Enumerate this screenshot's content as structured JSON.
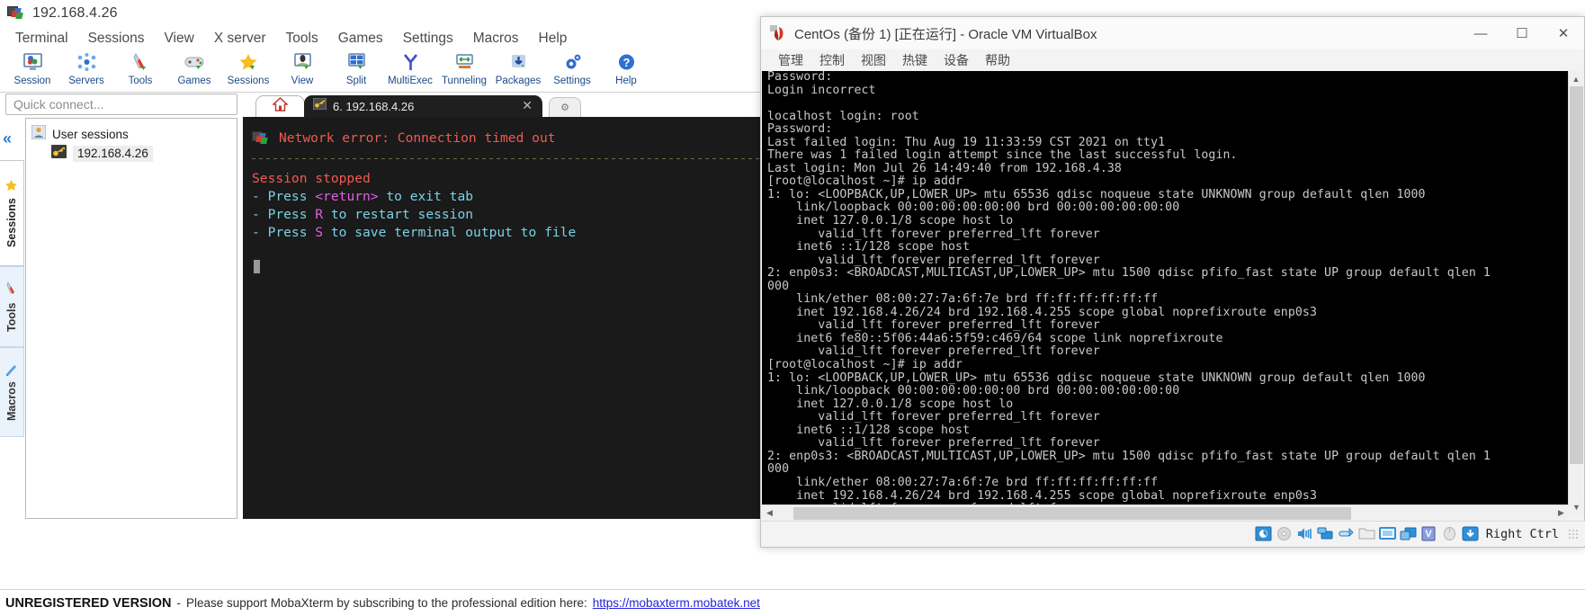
{
  "mobaxterm": {
    "title": "192.168.4.26",
    "title_icon": "mobaxterm-logo-icon",
    "menus": [
      "Terminal",
      "Sessions",
      "View",
      "X server",
      "Tools",
      "Games",
      "Settings",
      "Macros",
      "Help"
    ],
    "toolbar": [
      {
        "label": "Session",
        "icon": "session-icon"
      },
      {
        "label": "Servers",
        "icon": "servers-icon"
      },
      {
        "label": "Tools",
        "icon": "tools-icon"
      },
      {
        "label": "Games",
        "icon": "games-icon"
      },
      {
        "label": "Sessions",
        "icon": "sessions-star-icon"
      },
      {
        "label": "View",
        "icon": "view-icon"
      },
      {
        "label": "Split",
        "icon": "split-icon"
      },
      {
        "label": "MultiExec",
        "icon": "multiexec-icon"
      },
      {
        "label": "Tunneling",
        "icon": "tunneling-icon"
      },
      {
        "label": "Packages",
        "icon": "packages-icon"
      },
      {
        "label": "Settings",
        "icon": "settings-gear-icon"
      },
      {
        "label": "Help",
        "icon": "help-icon"
      }
    ],
    "quick_connect_placeholder": "Quick connect...",
    "side_tabs": [
      {
        "label": "Sessions",
        "icon": "star-icon",
        "active": true
      },
      {
        "label": "Tools",
        "icon": "swiss-knife-icon",
        "active": false
      },
      {
        "label": "Macros",
        "icon": "macro-icon",
        "active": false
      }
    ],
    "collapse_icon": "double-chevron-left-icon",
    "tree": {
      "root_label": "User sessions",
      "root_icon": "user-sessions-icon",
      "children": [
        {
          "label": "192.168.4.26",
          "icon": "ssh-key-icon",
          "selected": true
        }
      ]
    },
    "tabs": {
      "home_icon": "home-icon",
      "session_tab": {
        "label": "6. 192.168.4.26",
        "icon": "ssh-key-icon",
        "close_icon": "close-icon"
      },
      "new_tab_icon": "new-tab-icon"
    },
    "terminal": {
      "error_line": "Network error: Connection timed out",
      "error_icon": "mobaxterm-logo-icon",
      "stopped_title": "Session stopped",
      "hints": [
        {
          "prefix": "    - Press ",
          "key": "<return>",
          "suffix": " to exit tab"
        },
        {
          "prefix": "    - Press ",
          "key": "R",
          "suffix": " to restart session"
        },
        {
          "prefix": "    - Press ",
          "key": "S",
          "suffix": " to save terminal output to file"
        }
      ]
    },
    "status": {
      "badge": "UNREGISTERED VERSION",
      "dash": "-",
      "message": "Please support MobaXterm by subscribing to the professional edition here:",
      "link": "https://mobaxterm.mobatek.net"
    }
  },
  "virtualbox": {
    "title": "CentOs (备份 1) [正在运行] - Oracle VM VirtualBox",
    "title_icon": "virtualbox-vm-icon",
    "window_controls": {
      "minimize": "—",
      "maximize": "☐",
      "close": "✕"
    },
    "menus": [
      "管理",
      "控制",
      "视图",
      "热键",
      "设备",
      "帮助"
    ],
    "console_lines": [
      "Password:",
      "Login incorrect",
      "",
      "localhost login: root",
      "Password:",
      "Last failed login: Thu Aug 19 11:33:59 CST 2021 on tty1",
      "There was 1 failed login attempt since the last successful login.",
      "Last login: Mon Jul 26 14:49:40 from 192.168.4.38",
      "[root@localhost ~]# ip addr",
      "1: lo: <LOOPBACK,UP,LOWER_UP> mtu 65536 qdisc noqueue state UNKNOWN group default qlen 1000",
      "    link/loopback 00:00:00:00:00:00 brd 00:00:00:00:00:00",
      "    inet 127.0.0.1/8 scope host lo",
      "       valid_lft forever preferred_lft forever",
      "    inet6 ::1/128 scope host",
      "       valid_lft forever preferred_lft forever",
      "2: enp0s3: <BROADCAST,MULTICAST,UP,LOWER_UP> mtu 1500 qdisc pfifo_fast state UP group default qlen 1",
      "000",
      "    link/ether 08:00:27:7a:6f:7e brd ff:ff:ff:ff:ff:ff",
      "    inet 192.168.4.26/24 brd 192.168.4.255 scope global noprefixroute enp0s3",
      "       valid_lft forever preferred_lft forever",
      "    inet6 fe80::5f06:44a6:5f59:c469/64 scope link noprefixroute",
      "       valid_lft forever preferred_lft forever",
      "[root@localhost ~]# ip addr",
      "1: lo: <LOOPBACK,UP,LOWER_UP> mtu 65536 qdisc noqueue state UNKNOWN group default qlen 1000",
      "    link/loopback 00:00:00:00:00:00 brd 00:00:00:00:00:00",
      "    inet 127.0.0.1/8 scope host lo",
      "       valid_lft forever preferred_lft forever",
      "    inet6 ::1/128 scope host",
      "       valid_lft forever preferred_lft forever",
      "2: enp0s3: <BROADCAST,MULTICAST,UP,LOWER_UP> mtu 1500 qdisc pfifo_fast state UP group default qlen 1",
      "000",
      "    link/ether 08:00:27:7a:6f:7e brd ff:ff:ff:ff:ff:ff",
      "    inet 192.168.4.26/24 brd 192.168.4.255 scope global noprefixroute enp0s3",
      "       valid_lft forever preferred_lft forever"
    ],
    "status_icons": [
      "hard-disk-icon",
      "optical-disk-icon",
      "audio-icon",
      "network-icon",
      "usb-icon",
      "shared-folders-icon",
      "display-icon",
      "recording-icon",
      "virtualization-icon",
      "mouse-icon",
      "keyboard-icon"
    ],
    "host_key": "Right Ctrl",
    "scroll_arrows": {
      "up": "▲",
      "down": "▼",
      "left": "◀",
      "right": "▶"
    }
  },
  "colors": {
    "accent_blue": "#1b4a8a",
    "terminal_bg": "#1a1a1a",
    "error_red": "#f05a4f",
    "hint_cyan": "#79d2e6",
    "hint_magenta": "#e45ee4",
    "link_blue": "#2222dd"
  }
}
